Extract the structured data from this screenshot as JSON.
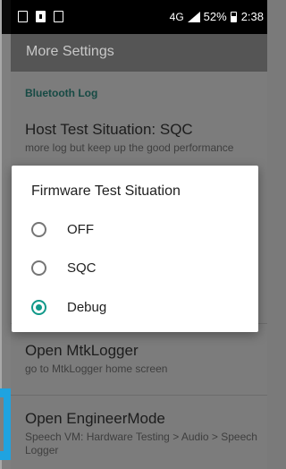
{
  "status_bar": {
    "network": "4G",
    "battery": "52%",
    "time": "2:38"
  },
  "toolbar": {
    "title": "More Settings"
  },
  "settings": {
    "section_header": "Bluetooth Log",
    "items": [
      {
        "title": "Host Test Situation: SQC",
        "summary": "more log but keep up the good performance"
      },
      {
        "title": "Open MtkLogger",
        "summary": "go to MtkLogger home screen"
      },
      {
        "title": "Open EngineerMode",
        "summary": "Speech VM: Hardware Testing > Audio > Speech Logger"
      }
    ]
  },
  "dialog": {
    "title": "Firmware Test Situation",
    "options": [
      {
        "label": "OFF",
        "selected": false
      },
      {
        "label": "SQC",
        "selected": false
      },
      {
        "label": "Debug",
        "selected": true
      }
    ]
  },
  "colors": {
    "accent": "#11998a",
    "status_bar": "#000000",
    "toolbar_dimmed": "#555555",
    "screen_dimmed": "#7c7c7c"
  },
  "icons": [
    "notification-icon",
    "sim-icon",
    "gallery-icon",
    "signal-icon",
    "battery-icon",
    "radio-button-icon"
  ]
}
